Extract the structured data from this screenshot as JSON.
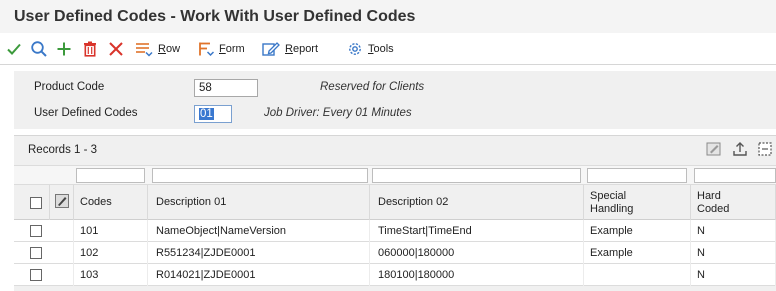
{
  "window": {
    "title": "User Defined Codes - Work With User Defined Codes"
  },
  "toolbar": {
    "row_label": "Row",
    "form_label": "Form",
    "report_label": "Report",
    "tools_label": "Tools",
    "colors": {
      "green": "#3c9a3c",
      "blue": "#3a78c8",
      "red": "#d9342b",
      "orange": "#e0732a"
    }
  },
  "header": {
    "product_code_label": "Product Code",
    "product_code_value": "58",
    "product_code_desc": "Reserved for Clients",
    "udc_label": "User Defined Codes",
    "udc_value": "01",
    "udc_desc": "Job Driver: Every 01 Minutes"
  },
  "grid": {
    "records_label": "Records 1 - 3",
    "columns": {
      "codes": "Codes",
      "desc1": "Description 01",
      "desc2": "Description 02",
      "special_1": "Special",
      "special_2": "Handling",
      "hard_1": "Hard",
      "hard_2": "Coded"
    },
    "rows": [
      {
        "code": "101",
        "desc1": "NameObject|NameVersion",
        "desc2": "TimeStart|TimeEnd",
        "special": "Example",
        "hard": "N"
      },
      {
        "code": "102",
        "desc1": "R551234|ZJDE0001",
        "desc2": "060000|180000",
        "special": "Example",
        "hard": "N"
      },
      {
        "code": "103",
        "desc1": "R014021|ZJDE0001",
        "desc2": "180100|180000",
        "special": "",
        "hard": "N"
      }
    ]
  }
}
